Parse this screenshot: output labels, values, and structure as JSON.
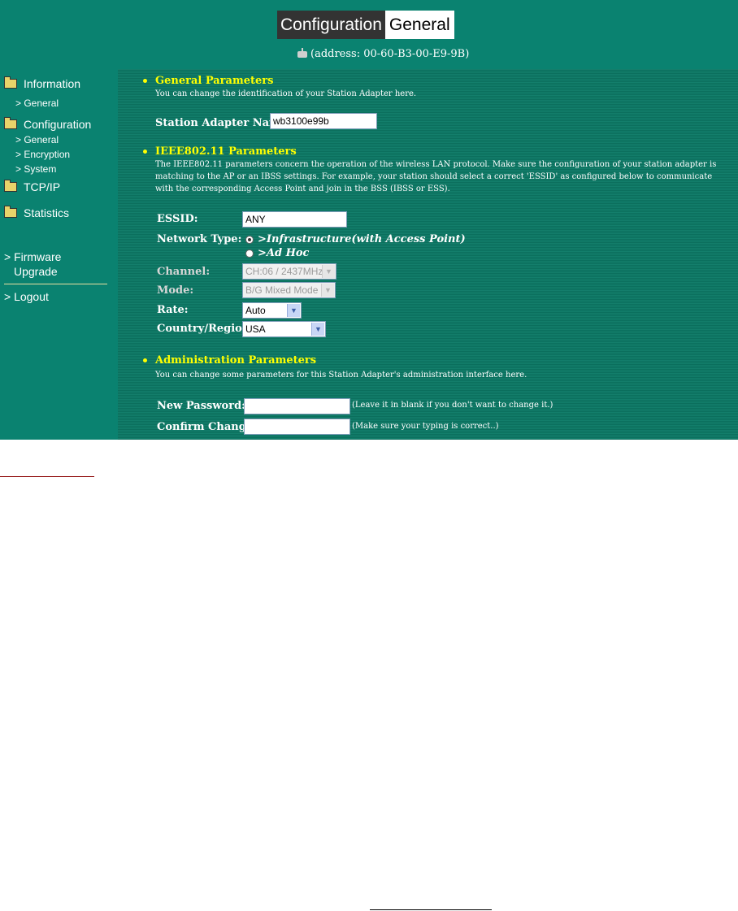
{
  "header": {
    "title_part1": "Configuration",
    "title_part2": "General",
    "address": "(address: 00-60-B3-00-E9-9B)"
  },
  "sidebar": {
    "information": "Information",
    "information_general": "> General",
    "configuration": "Configuration",
    "configuration_general": "> General",
    "configuration_encryption": "> Encryption",
    "configuration_system": "> System",
    "tcpip": "TCP/IP",
    "statistics": "Statistics",
    "firmware_line1": "> Firmware",
    "firmware_line2": "Upgrade",
    "logout": "> Logout"
  },
  "general": {
    "title": "General Parameters",
    "description": "You can change the identification of your Station Adapter here.",
    "station_name_label": "Station Adapter Name:",
    "station_name_value": "wb3100e99b"
  },
  "ieee": {
    "title": "IEEE802.11 Parameters",
    "description": "The IEEE802.11 parameters concern the operation of the wireless LAN protocol. Make sure the configuration of your station adapter is matching to the AP or an IBSS settings. For example, your station should select a correct 'ESSID' as configured below to communicate with the corresponding Access Point and join in the BSS (IBSS or ESS).",
    "essid_label": "ESSID:",
    "essid_value": "ANY",
    "network_type_label": "Network Type:",
    "infrastructure_label": ">Infrastructure(with Access Point)",
    "adhoc_label": ">Ad Hoc",
    "channel_label": "Channel:",
    "channel_value": "CH:06 / 2437MHz",
    "mode_label": "Mode:",
    "mode_value": "B/G Mixed Mode",
    "rate_label": "Rate:",
    "rate_value": "Auto",
    "country_label": "Country/Region:",
    "country_value": "USA"
  },
  "admin": {
    "title": "Administration Parameters",
    "description": "You can change some parameters for this Station Adapter's administration interface here.",
    "new_password_label": "New Password:",
    "new_password_hint": "(Leave it in blank if you don't want to change it.)",
    "confirm_label": "Confirm Change:",
    "confirm_hint": "(Make sure your typing is correct..)"
  }
}
